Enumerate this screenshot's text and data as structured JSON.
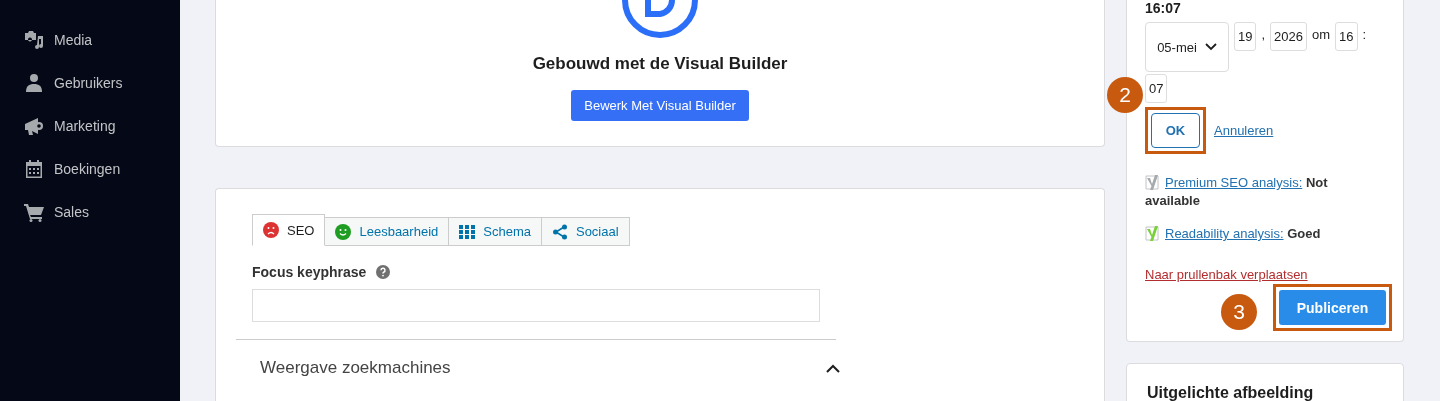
{
  "sidebar": {
    "items": [
      {
        "label": "Media",
        "kind": "media"
      },
      {
        "label": "Gebruikers",
        "kind": "user"
      },
      {
        "label": "Marketing",
        "kind": "megaphone"
      },
      {
        "label": "Boekingen",
        "kind": "calendar"
      },
      {
        "label": "Sales",
        "kind": "cart"
      }
    ]
  },
  "builder": {
    "title": "Gebouwd met de Visual Builder",
    "button": "Bewerk Met Visual Builder"
  },
  "seo_box": {
    "tabs": [
      {
        "label": "SEO",
        "kind": "sad",
        "selected": true
      },
      {
        "label": "Leesbaarheid",
        "kind": "happy",
        "selected": false
      },
      {
        "label": "Schema",
        "kind": "grid",
        "selected": false
      },
      {
        "label": "Sociaal",
        "kind": "share",
        "selected": false
      }
    ],
    "focus_label": "Focus keyphrase",
    "section": {
      "title": "Weergave zoekmachines",
      "expanded": true
    }
  },
  "publish": {
    "time": "16:07",
    "date_fields": [
      {
        "kind": "select",
        "text": "05-mei"
      },
      {
        "kind": "field",
        "text": "19"
      },
      {
        "kind": "text",
        "text": ","
      },
      {
        "kind": "field",
        "text": "2026"
      },
      {
        "kind": "text",
        "text": "om"
      },
      {
        "kind": "field",
        "text": "16"
      },
      {
        "kind": "text",
        "text": ":"
      },
      {
        "kind": "field",
        "text": "07"
      }
    ],
    "ok": "OK",
    "cancel": "Annuleren",
    "analyses": [
      {
        "link": "Premium SEO analysis:",
        "result": "Not available",
        "color": "#a7aaad"
      },
      {
        "link": "Readability analysis:",
        "result": "Goed",
        "color": "#7ad03a"
      }
    ],
    "trash": "Naar prullenbak verplaatsen",
    "publish_button": "Publiceren",
    "annotations": [
      {
        "number": "2"
      },
      {
        "number": "3"
      }
    ]
  },
  "featured_image": {
    "title": "Uitgelichte afbeelding"
  }
}
